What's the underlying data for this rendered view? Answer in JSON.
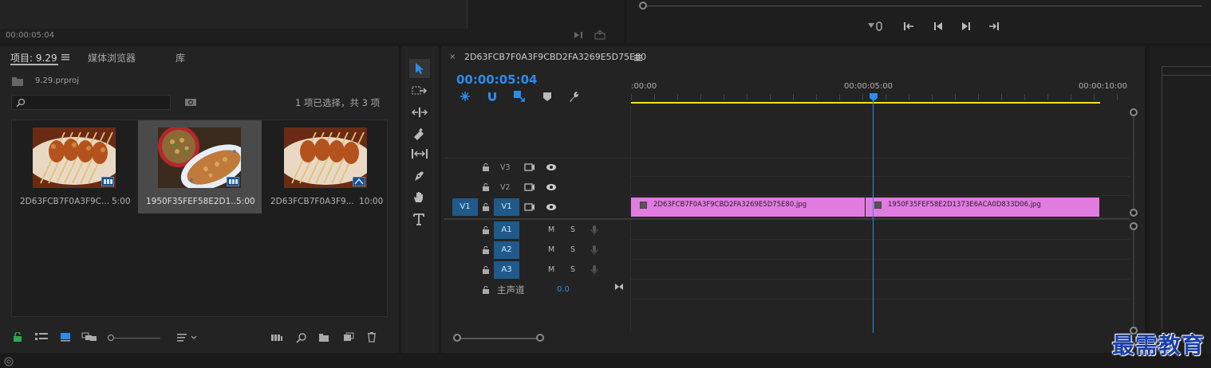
{
  "top_left_panel": {
    "timecode": "00:00:05:04"
  },
  "project_panel": {
    "tabs": [
      {
        "label": "项目: 9.29"
      },
      {
        "label": "媒体浏览器"
      },
      {
        "label": "库"
      }
    ],
    "project_file": "9.29.prproj",
    "selection_status": "1 项已选择，共 3 项",
    "search_placeholder": "",
    "items": [
      {
        "name": "2D63FCB7F0A3F9C...",
        "duration": "5:00",
        "selected": false
      },
      {
        "name": "1950F35FEF58E2D1...",
        "duration": "5:00",
        "selected": true
      },
      {
        "name": "2D63FCB7F0A3F9...",
        "duration": "10:00",
        "selected": false
      }
    ]
  },
  "timeline": {
    "sequence_name": "2D63FCB7F0A3F9CBD2FA3269E5D75E80",
    "timecode": "00:00:05:04",
    "ruler": {
      "start": ":00:00",
      "mid": "00:00:05:00",
      "end": "00:00:10:00"
    },
    "video_tracks": [
      {
        "label": "V3"
      },
      {
        "label": "V2"
      },
      {
        "label": "V1",
        "source": "V1"
      }
    ],
    "audio_tracks": [
      {
        "label": "A1",
        "m": "M",
        "s": "S"
      },
      {
        "label": "A2",
        "m": "M",
        "s": "S"
      },
      {
        "label": "A3",
        "m": "M",
        "s": "S"
      }
    ],
    "master": {
      "label": "主声道",
      "value": "0.0"
    },
    "clips": [
      {
        "name": "2D63FCB7F0A3F9CBD2FA3269E5D75E80.jpg"
      },
      {
        "name": "1950F35FEF58E2D1373E6ACA0D833D06.jpg"
      }
    ],
    "playhead_seconds": 5.17,
    "clip_color": "#e17be0"
  },
  "watermark": "最需教育",
  "colors": {
    "accent": "#2d8ceb",
    "work_area": "#f0e41a"
  }
}
